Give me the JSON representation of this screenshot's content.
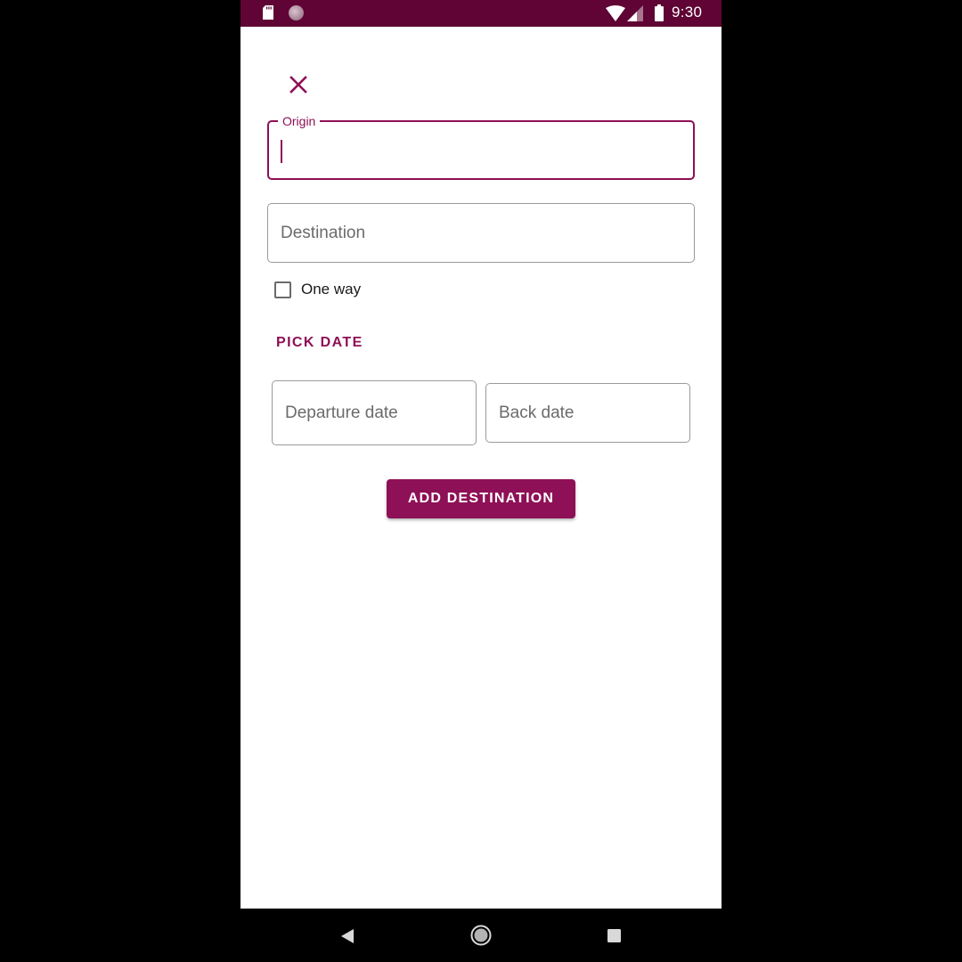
{
  "status_bar": {
    "time": "9:30",
    "icons": [
      "sd-card-icon",
      "notification-circle-icon",
      "wifi-icon",
      "cell-signal-icon",
      "battery-icon"
    ],
    "background_color": "#5f0434"
  },
  "form": {
    "close_icon": "close-icon",
    "origin": {
      "label": "Origin",
      "value": "",
      "focused": true
    },
    "destination": {
      "placeholder": "Destination",
      "value": ""
    },
    "one_way": {
      "label": "One way",
      "checked": false
    },
    "pick_date_label": "PICK DATE",
    "departure_date": {
      "placeholder": "Departure date"
    },
    "back_date": {
      "placeholder": "Back date"
    },
    "add_button_label": "ADD DESTINATION"
  },
  "nav_bar": {
    "icons": [
      "back-icon",
      "home-icon",
      "recents-icon"
    ]
  },
  "colors": {
    "accent": "#8e1056",
    "status_bar": "#5f0434",
    "border": "#9a9a9a",
    "placeholder_text": "#6b6b6b"
  }
}
